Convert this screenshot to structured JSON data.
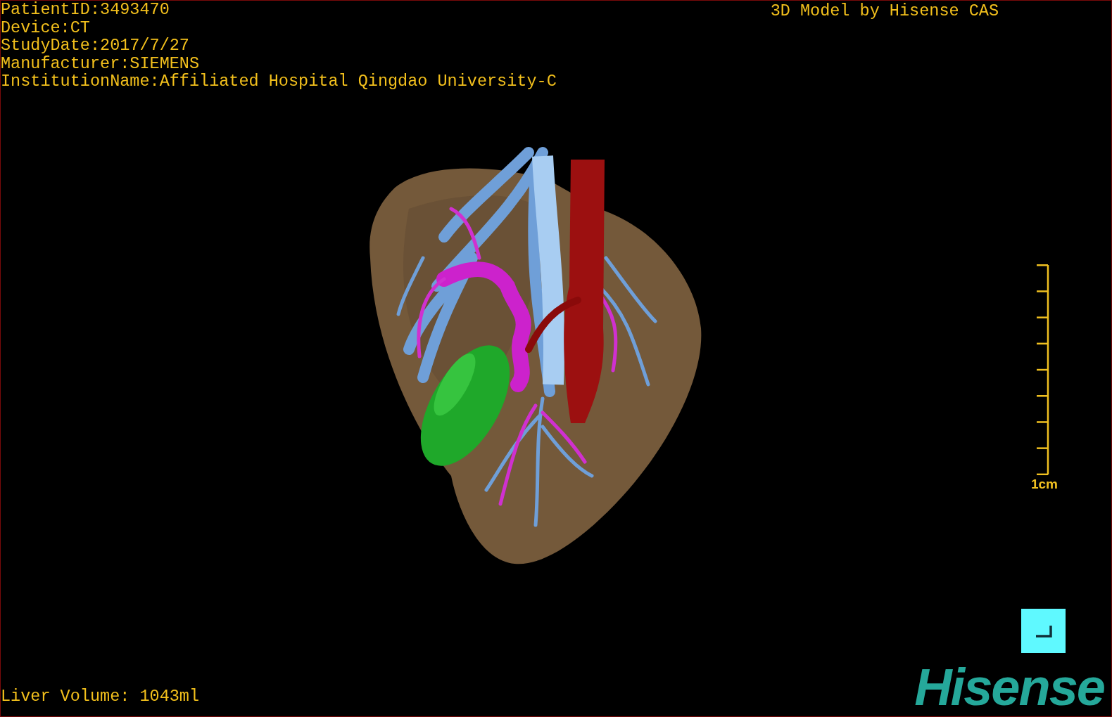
{
  "patient_info": [
    "PatientID:3493470",
    "Device:CT",
    "StudyDate:2017/7/27",
    "Manufacturer:SIEMENS",
    "InstitutionName:Affiliated Hospital Qingdao University-C"
  ],
  "model_title": "3D Model by Hisense CAS",
  "scale_bar": {
    "label": "1cm"
  },
  "liver_volume": "Liver Volume: 1043ml",
  "logo": "Hisense"
}
